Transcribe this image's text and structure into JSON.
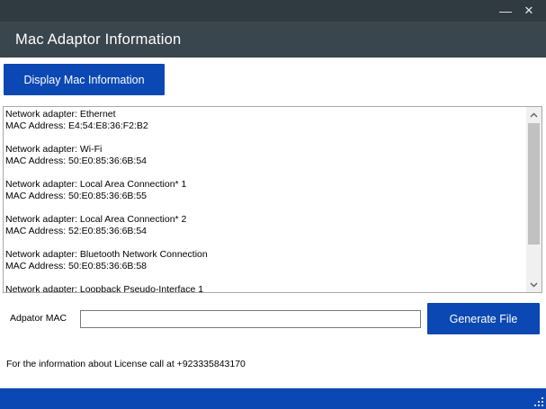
{
  "window": {
    "minimize_glyph": "—",
    "close_glyph": "✕"
  },
  "header": {
    "title": "Mac Adaptor Information"
  },
  "buttons": {
    "display": "Display Mac Information",
    "generate": "Generate File"
  },
  "adapters": [
    {
      "name": "Network adapter: Ethernet",
      "mac": "MAC Address: E4:54:E8:36:F2:B2"
    },
    {
      "name": "Network adapter: Wi-Fi",
      "mac": "MAC Address: 50:E0:85:36:6B:54"
    },
    {
      "name": "Network adapter: Local Area Connection* 1",
      "mac": "MAC Address: 50:E0:85:36:6B:55"
    },
    {
      "name": "Network adapter: Local Area Connection* 2",
      "mac": "MAC Address: 52:E0:85:36:6B:54"
    },
    {
      "name": "Network adapter: Bluetooth Network Connection",
      "mac": "MAC Address: 50:E0:85:36:6B:58"
    },
    {
      "name": "Network adapter: Loopback Pseudo-Interface 1",
      "mac": ""
    }
  ],
  "form": {
    "mac_label": "Adpator MAC",
    "mac_value": ""
  },
  "footer": {
    "license_text": "For the information about License call at +923335843170"
  },
  "icons": {
    "minimize": "minimize-icon",
    "close": "close-icon",
    "scroll_up": "chevron-up-icon",
    "scroll_down": "chevron-down-icon",
    "resize": "resize-grip-icon"
  },
  "colors": {
    "titlebar": "#2f3a41",
    "header": "#3a464d",
    "accent": "#0b48b3"
  }
}
